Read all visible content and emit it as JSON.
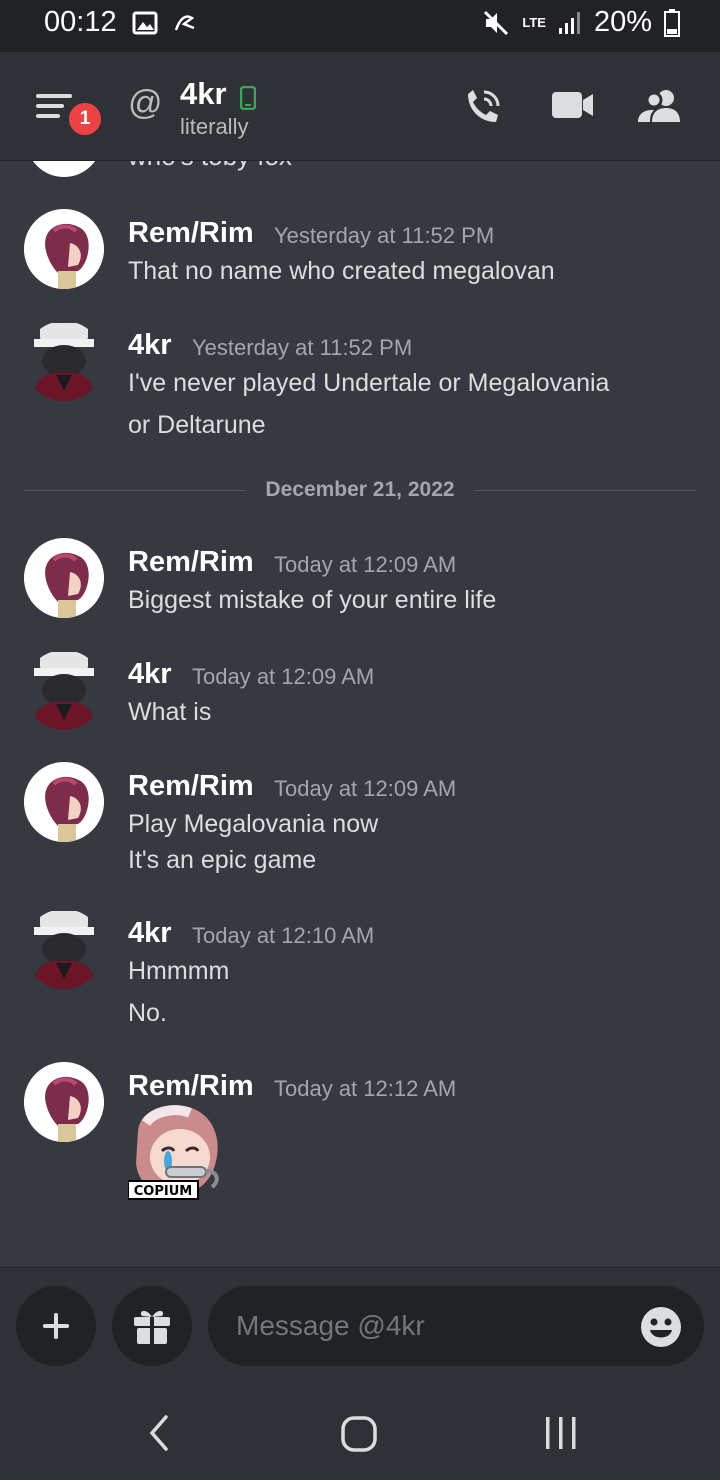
{
  "status_bar": {
    "time": "00:12",
    "network": "LTE",
    "battery": "20%"
  },
  "header": {
    "notification_count": "1",
    "at_symbol": "@",
    "channel_name": "4kr",
    "channel_status": "literally"
  },
  "chat": {
    "cut_off_text": "who's toby fox",
    "divider_date": "December 21, 2022",
    "messages": [
      {
        "author": "Rem/Rim",
        "time": "Yesterday at 11:52 PM",
        "lines": [
          "That no name who created megalovan"
        ]
      },
      {
        "author": "4kr",
        "time": "Yesterday at 11:52 PM",
        "lines": [
          "I've never played Undertale or Megalovania",
          "or Deltarune"
        ]
      },
      {
        "author": "Rem/Rim",
        "time": "Today at 12:09 AM",
        "lines": [
          "Biggest mistake of your entire life"
        ]
      },
      {
        "author": "4kr",
        "time": "Today at 12:09 AM",
        "lines": [
          "What is"
        ]
      },
      {
        "author": "Rem/Rim",
        "time": "Today at 12:09 AM",
        "lines": [
          "Play Megalovania now",
          "It's an epic game"
        ]
      },
      {
        "author": "4kr",
        "time": "Today at 12:10 AM",
        "lines": [
          "Hmmmm",
          "No."
        ]
      },
      {
        "author": "Rem/Rim",
        "time": "Today at 12:12 AM",
        "lines": []
      }
    ],
    "sticker_label": "COPIUM"
  },
  "composer": {
    "placeholder": "Message @4kr"
  },
  "colors": {
    "background": "#36393f",
    "header": "#2f3136",
    "accent_red": "#ed4245",
    "online_green": "#3ba55c"
  }
}
